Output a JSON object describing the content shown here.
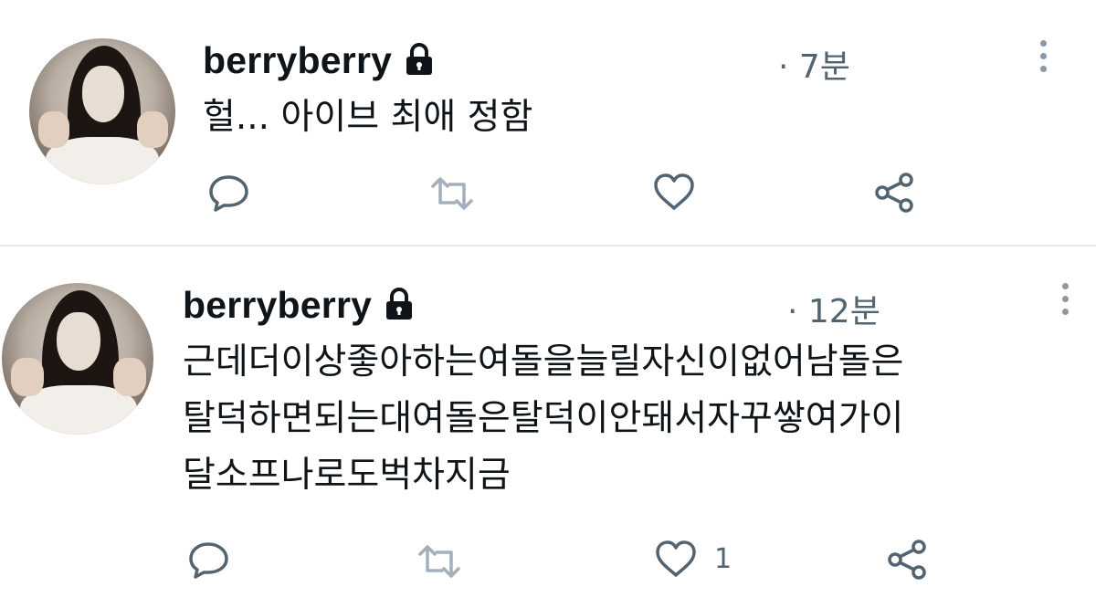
{
  "tweets": [
    {
      "username": "berryberry",
      "time": "· 7분",
      "text_lines": [
        "헐... 아이브 최애 정함"
      ],
      "like_count": ""
    },
    {
      "username": "berryberry",
      "time": "· 12분",
      "text_lines": [
        "근데더이상좋아하는여돌을늘릴자신이없어남돌은",
        "탈덕하면되는대여돌은탈덕이안돼서자꾸쌓여가이",
        "달소프나로도벅차지금"
      ],
      "like_count": "1"
    }
  ],
  "icons": {
    "protected": "lock-icon",
    "more": "more-vertical-icon",
    "reply": "reply-bubble-icon",
    "retweet": "retweet-icon",
    "like": "heart-icon",
    "share": "share-icon"
  },
  "colors": {
    "text": "#0f1419",
    "muted": "#536471",
    "icon": "#536471",
    "divider": "#e6e9ec"
  }
}
